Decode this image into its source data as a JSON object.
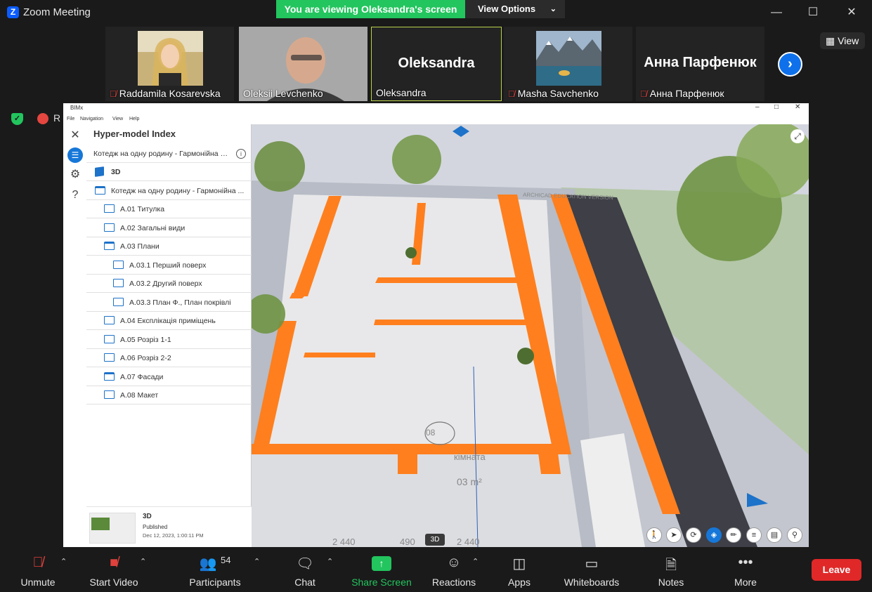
{
  "window": {
    "title": "Zoom Meeting",
    "logo": "Z"
  },
  "banner": {
    "text": "You are viewing Oleksandra's screen",
    "view_options": "View Options"
  },
  "gallery": {
    "participants": [
      {
        "name": "Raddamila Kosarevska",
        "muted": true,
        "video": true
      },
      {
        "name": "Oleksii Levchenko",
        "muted": false,
        "video": true
      },
      {
        "name": "Oleksandra",
        "muted": false,
        "video": false,
        "active": true
      },
      {
        "name": "Masha Savchenko",
        "muted": true,
        "video": true
      },
      {
        "name": "Анна Парфенюк",
        "muted": true,
        "video": false
      }
    ],
    "view_button": "View"
  },
  "status": {
    "recording_label": "R"
  },
  "bimx": {
    "title": "BIMx",
    "menu": [
      "File",
      "Navigation",
      "View",
      "Help"
    ],
    "panel_title": "Hyper-model Index",
    "project_name": "Котедж на одну родину - Гармонійна о...",
    "tree": [
      {
        "label": "3D",
        "type": "cube",
        "indent": 0,
        "bold": true
      },
      {
        "label": "Котедж на одну родину - Гармонійна ...",
        "type": "folder",
        "indent": 0
      },
      {
        "label": "A.01 Титулка",
        "type": "sheet",
        "indent": 1
      },
      {
        "label": "A.02 Загальні види",
        "type": "sheet",
        "indent": 1
      },
      {
        "label": "A.03 Плани",
        "type": "folder",
        "indent": 1
      },
      {
        "label": "A.03.1 Перший поверх",
        "type": "sheet",
        "indent": 2
      },
      {
        "label": "A.03.2 Другий поверх",
        "type": "sheet",
        "indent": 2
      },
      {
        "label": "A.03.3 План Ф., План покрівлі",
        "type": "sheet",
        "indent": 2
      },
      {
        "label": "A.04 Експлікація приміщень",
        "type": "sheet",
        "indent": 1
      },
      {
        "label": "A.05 Розріз 1-1",
        "type": "sheet",
        "indent": 1
      },
      {
        "label": "A.06 Розріз 2-2",
        "type": "sheet",
        "indent": 1
      },
      {
        "label": "A.07 Фасади",
        "type": "folder",
        "indent": 1
      },
      {
        "label": "A.08 Макет",
        "type": "sheet",
        "indent": 1
      }
    ],
    "thumb": {
      "name": "3D",
      "status": "Published",
      "date": "Dec 12, 2023, 1:00:11 PM"
    },
    "viewport": {
      "room_number": "08",
      "room_name": "кімната",
      "room_area": "03 m²",
      "dimensions": [
        "2 440",
        "490",
        "2 440"
      ],
      "watermark": "ARCHICAD EDUCATION VERSION",
      "badge": "3D"
    }
  },
  "toolbar": {
    "items": [
      {
        "label": "Unmute"
      },
      {
        "label": "Start Video"
      },
      {
        "label": "Participants",
        "count": "54"
      },
      {
        "label": "Chat"
      },
      {
        "label": "Share Screen"
      },
      {
        "label": "Reactions"
      },
      {
        "label": "Apps"
      },
      {
        "label": "Whiteboards"
      },
      {
        "label": "Notes"
      },
      {
        "label": "More"
      }
    ],
    "leave": "Leave"
  },
  "colors": {
    "accent": "#23c55e",
    "leave": "#e02828",
    "zoom_blue": "#0e71eb",
    "wall": "#ff7f1e"
  }
}
